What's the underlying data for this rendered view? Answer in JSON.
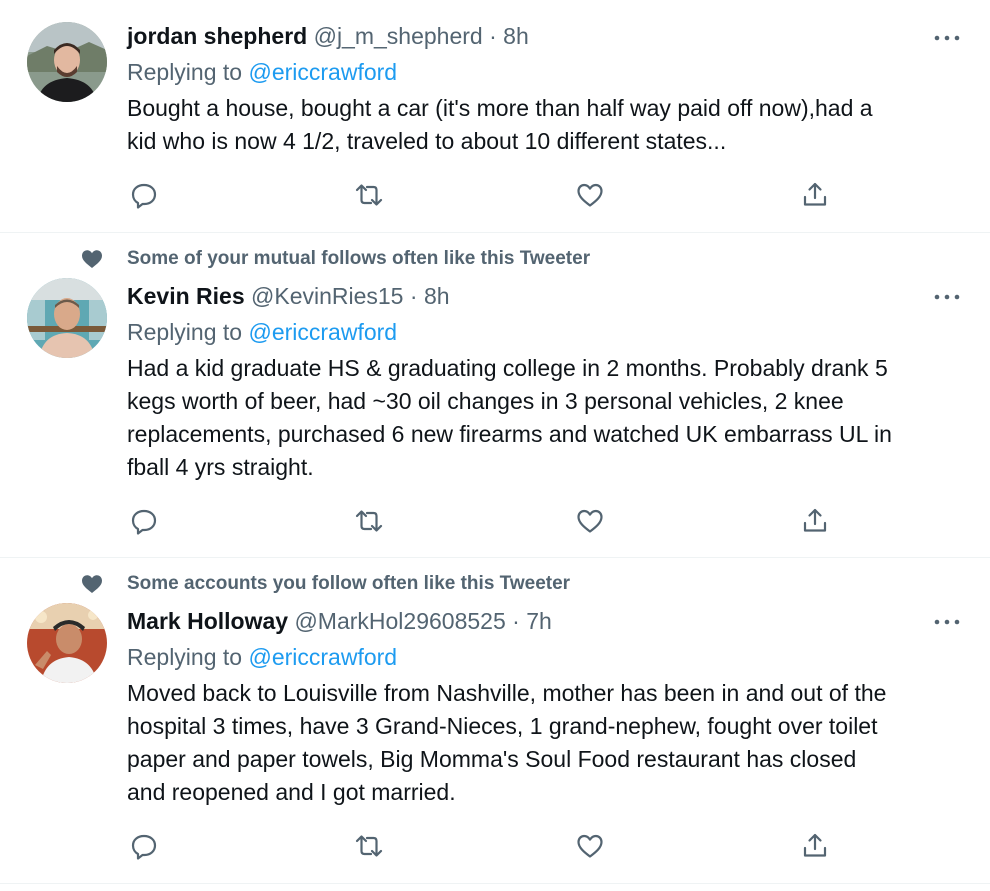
{
  "colors": {
    "text": "#0f1419",
    "secondary": "#536471",
    "link": "#1d9bf0",
    "divider": "#eff3f4"
  },
  "icons": {
    "reply": "reply-icon",
    "retweet": "retweet-icon",
    "like": "like-icon",
    "share": "share-icon",
    "more": "more-icon",
    "social_context": "heart-icon"
  },
  "tweets": [
    {
      "social_context": "",
      "name": "jordan shepherd",
      "handle": "@j_m_shepherd",
      "time": "8h",
      "replying_label": "Replying to",
      "replying_to": "@ericcrawford",
      "text": "Bought a house, bought a car (it's more than half way paid off now),had a\nkid who is now 4 1/2, traveled to about 10 different states..."
    },
    {
      "social_context": "Some of your mutual follows often like this Tweeter",
      "name": "Kevin Ries",
      "handle": "@KevinRies15",
      "time": "8h",
      "replying_label": "Replying to",
      "replying_to": "@ericcrawford",
      "text": "Had a kid graduate HS & graduating college in 2 months.  Probably drank 5\nkegs worth of beer, had ~30 oil changes in 3 personal vehicles, 2 knee\nreplacements, purchased 6 new firearms and watched UK embarrass UL in\nfball 4 yrs straight."
    },
    {
      "social_context": "Some accounts you follow often like this Tweeter",
      "name": "Mark Holloway",
      "handle": "@MarkHol29608525",
      "time": "7h",
      "replying_label": "Replying to",
      "replying_to": "@ericcrawford",
      "text": "Moved back to Louisville from Nashville,  mother has been in and out of the\nhospital 3 times,  have 3 Grand-Nieces,  1 grand-nephew, fought over toilet\npaper and paper towels,  Big Momma's Soul Food restaurant has closed\nand reopened and I got married."
    }
  ]
}
